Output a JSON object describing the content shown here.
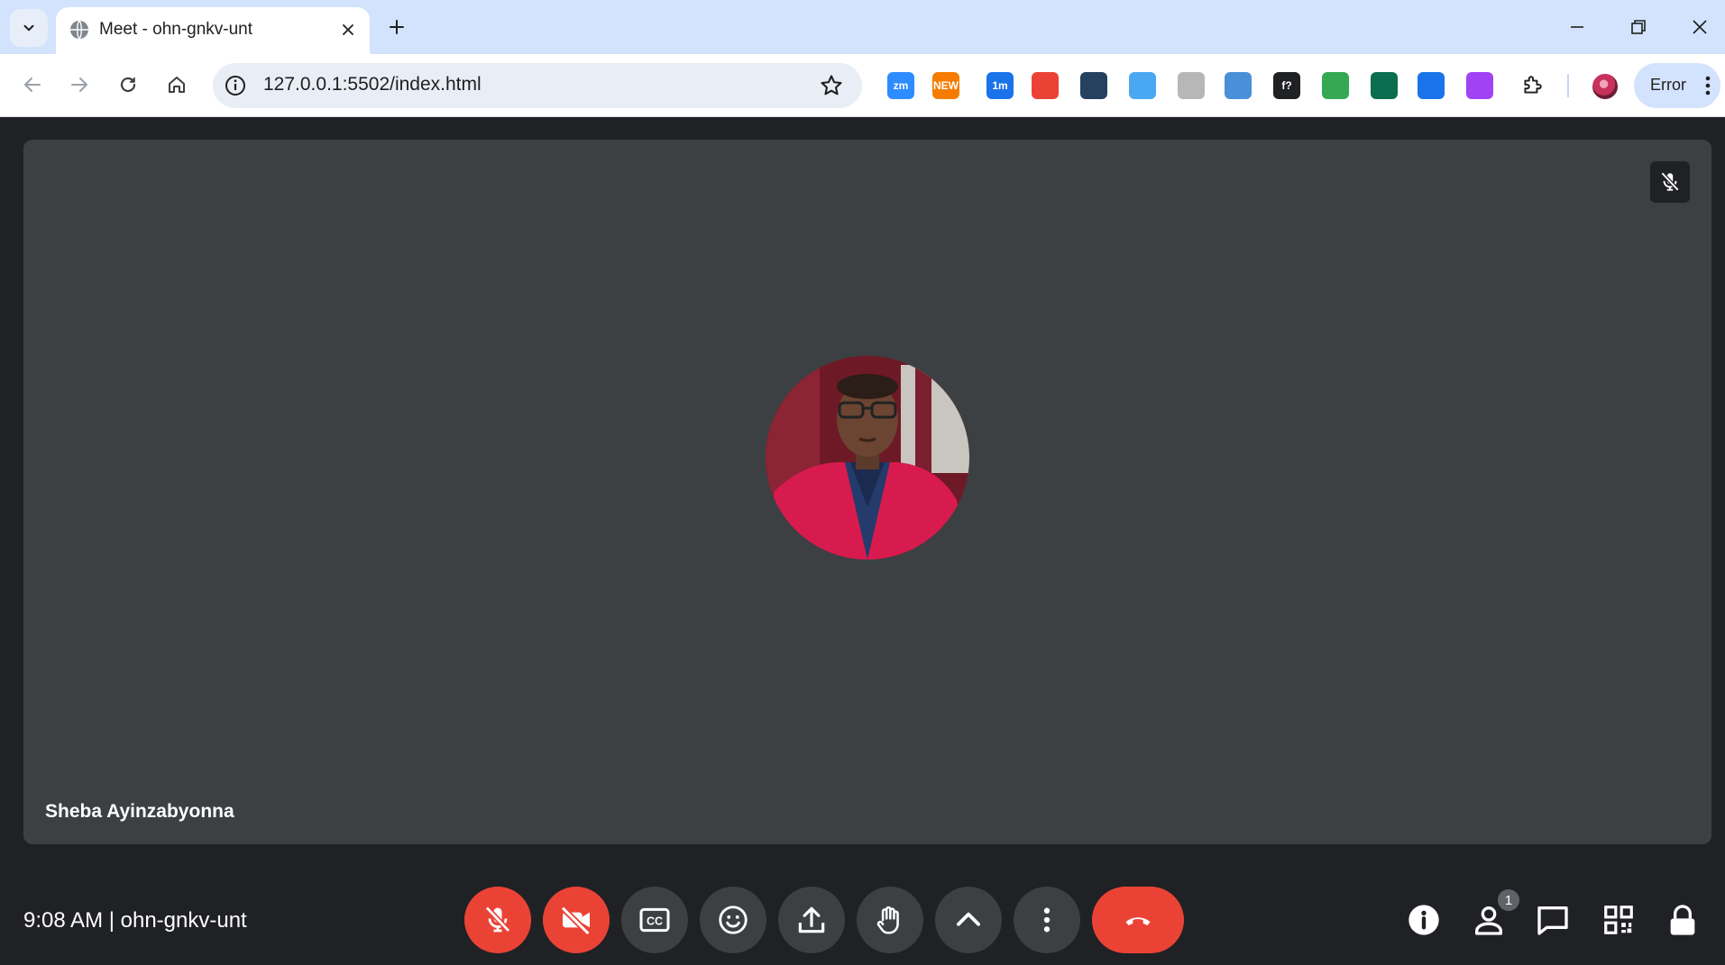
{
  "browser": {
    "tab_title": "Meet - ohn-gnkv-unt",
    "url": "127.0.0.1:5502/index.html",
    "profile_button_label": "Error",
    "extensions": [
      {
        "name": "zoom-extension-icon",
        "label": "zm",
        "color": "#2d8cff"
      },
      {
        "name": "new-badge-extension-icon",
        "label": "NEW",
        "color": "#f57c00"
      },
      {
        "name": "timer-extension-icon",
        "label": "1m",
        "color": "#1a73e8"
      },
      {
        "name": "color-picker-extension-icon",
        "label": "",
        "color": "#ea4335"
      },
      {
        "name": "browser-app-extension-icon",
        "label": "",
        "color": "#24415e"
      },
      {
        "name": "cat-extension-icon",
        "label": "",
        "color": "#4aa8f2"
      },
      {
        "name": "glasses-extension-icon",
        "label": "",
        "color": "#b7b7b7"
      },
      {
        "name": "phone-extension-icon",
        "label": "",
        "color": "#4a90d9"
      },
      {
        "name": "font-extension-icon",
        "label": "f?",
        "color": "#202124"
      },
      {
        "name": "shield-extension-icon",
        "label": "",
        "color": "#34a853"
      },
      {
        "name": "record-extension-icon",
        "label": "",
        "color": "#0b6e4f"
      },
      {
        "name": "pen-extension-icon",
        "label": "",
        "color": "#1a73e8"
      },
      {
        "name": "gradient-extension-icon",
        "label": "",
        "color": "#a142f4"
      }
    ]
  },
  "meeting": {
    "participant_name": "Sheba Ayinzabyonna",
    "time": "9:08 AM",
    "separator": "|",
    "code": "ohn-gnkv-unt",
    "people_count": "1"
  },
  "colors": {
    "stage_background": "#202124",
    "tile_background": "#3c4043",
    "danger_red": "#ea4335",
    "tabstrip": "#d3e3fd"
  }
}
